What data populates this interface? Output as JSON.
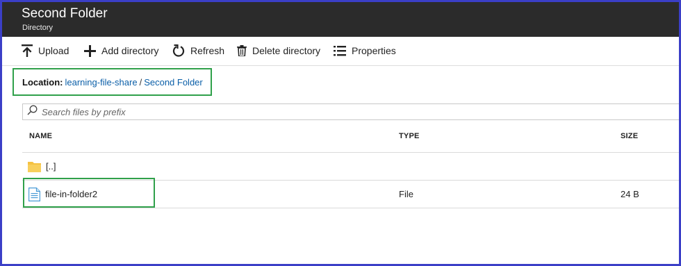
{
  "header": {
    "title": "Second Folder",
    "subtitle": "Directory"
  },
  "toolbar": {
    "upload_label": "Upload",
    "add_directory_label": "Add directory",
    "refresh_label": "Refresh",
    "delete_directory_label": "Delete directory",
    "properties_label": "Properties"
  },
  "location": {
    "label": "Location:",
    "share_link": "learning-file-share",
    "separator": "/",
    "folder_link": "Second Folder"
  },
  "search": {
    "placeholder": "Search files by prefix",
    "value": ""
  },
  "table": {
    "columns": {
      "name": "NAME",
      "type": "TYPE",
      "size": "SIZE"
    },
    "rows": [
      {
        "name": "[..]",
        "type": "",
        "size": "",
        "icon": "folder-icon"
      },
      {
        "name": "file-in-folder2",
        "type": "File",
        "size": "24 B",
        "icon": "file-icon"
      }
    ]
  },
  "colors": {
    "header_bg": "#2b2b2b",
    "link": "#0b5fa8",
    "highlight": "#2fa04a",
    "frame_border": "#3b3fc7",
    "folder": "#f5c242"
  }
}
